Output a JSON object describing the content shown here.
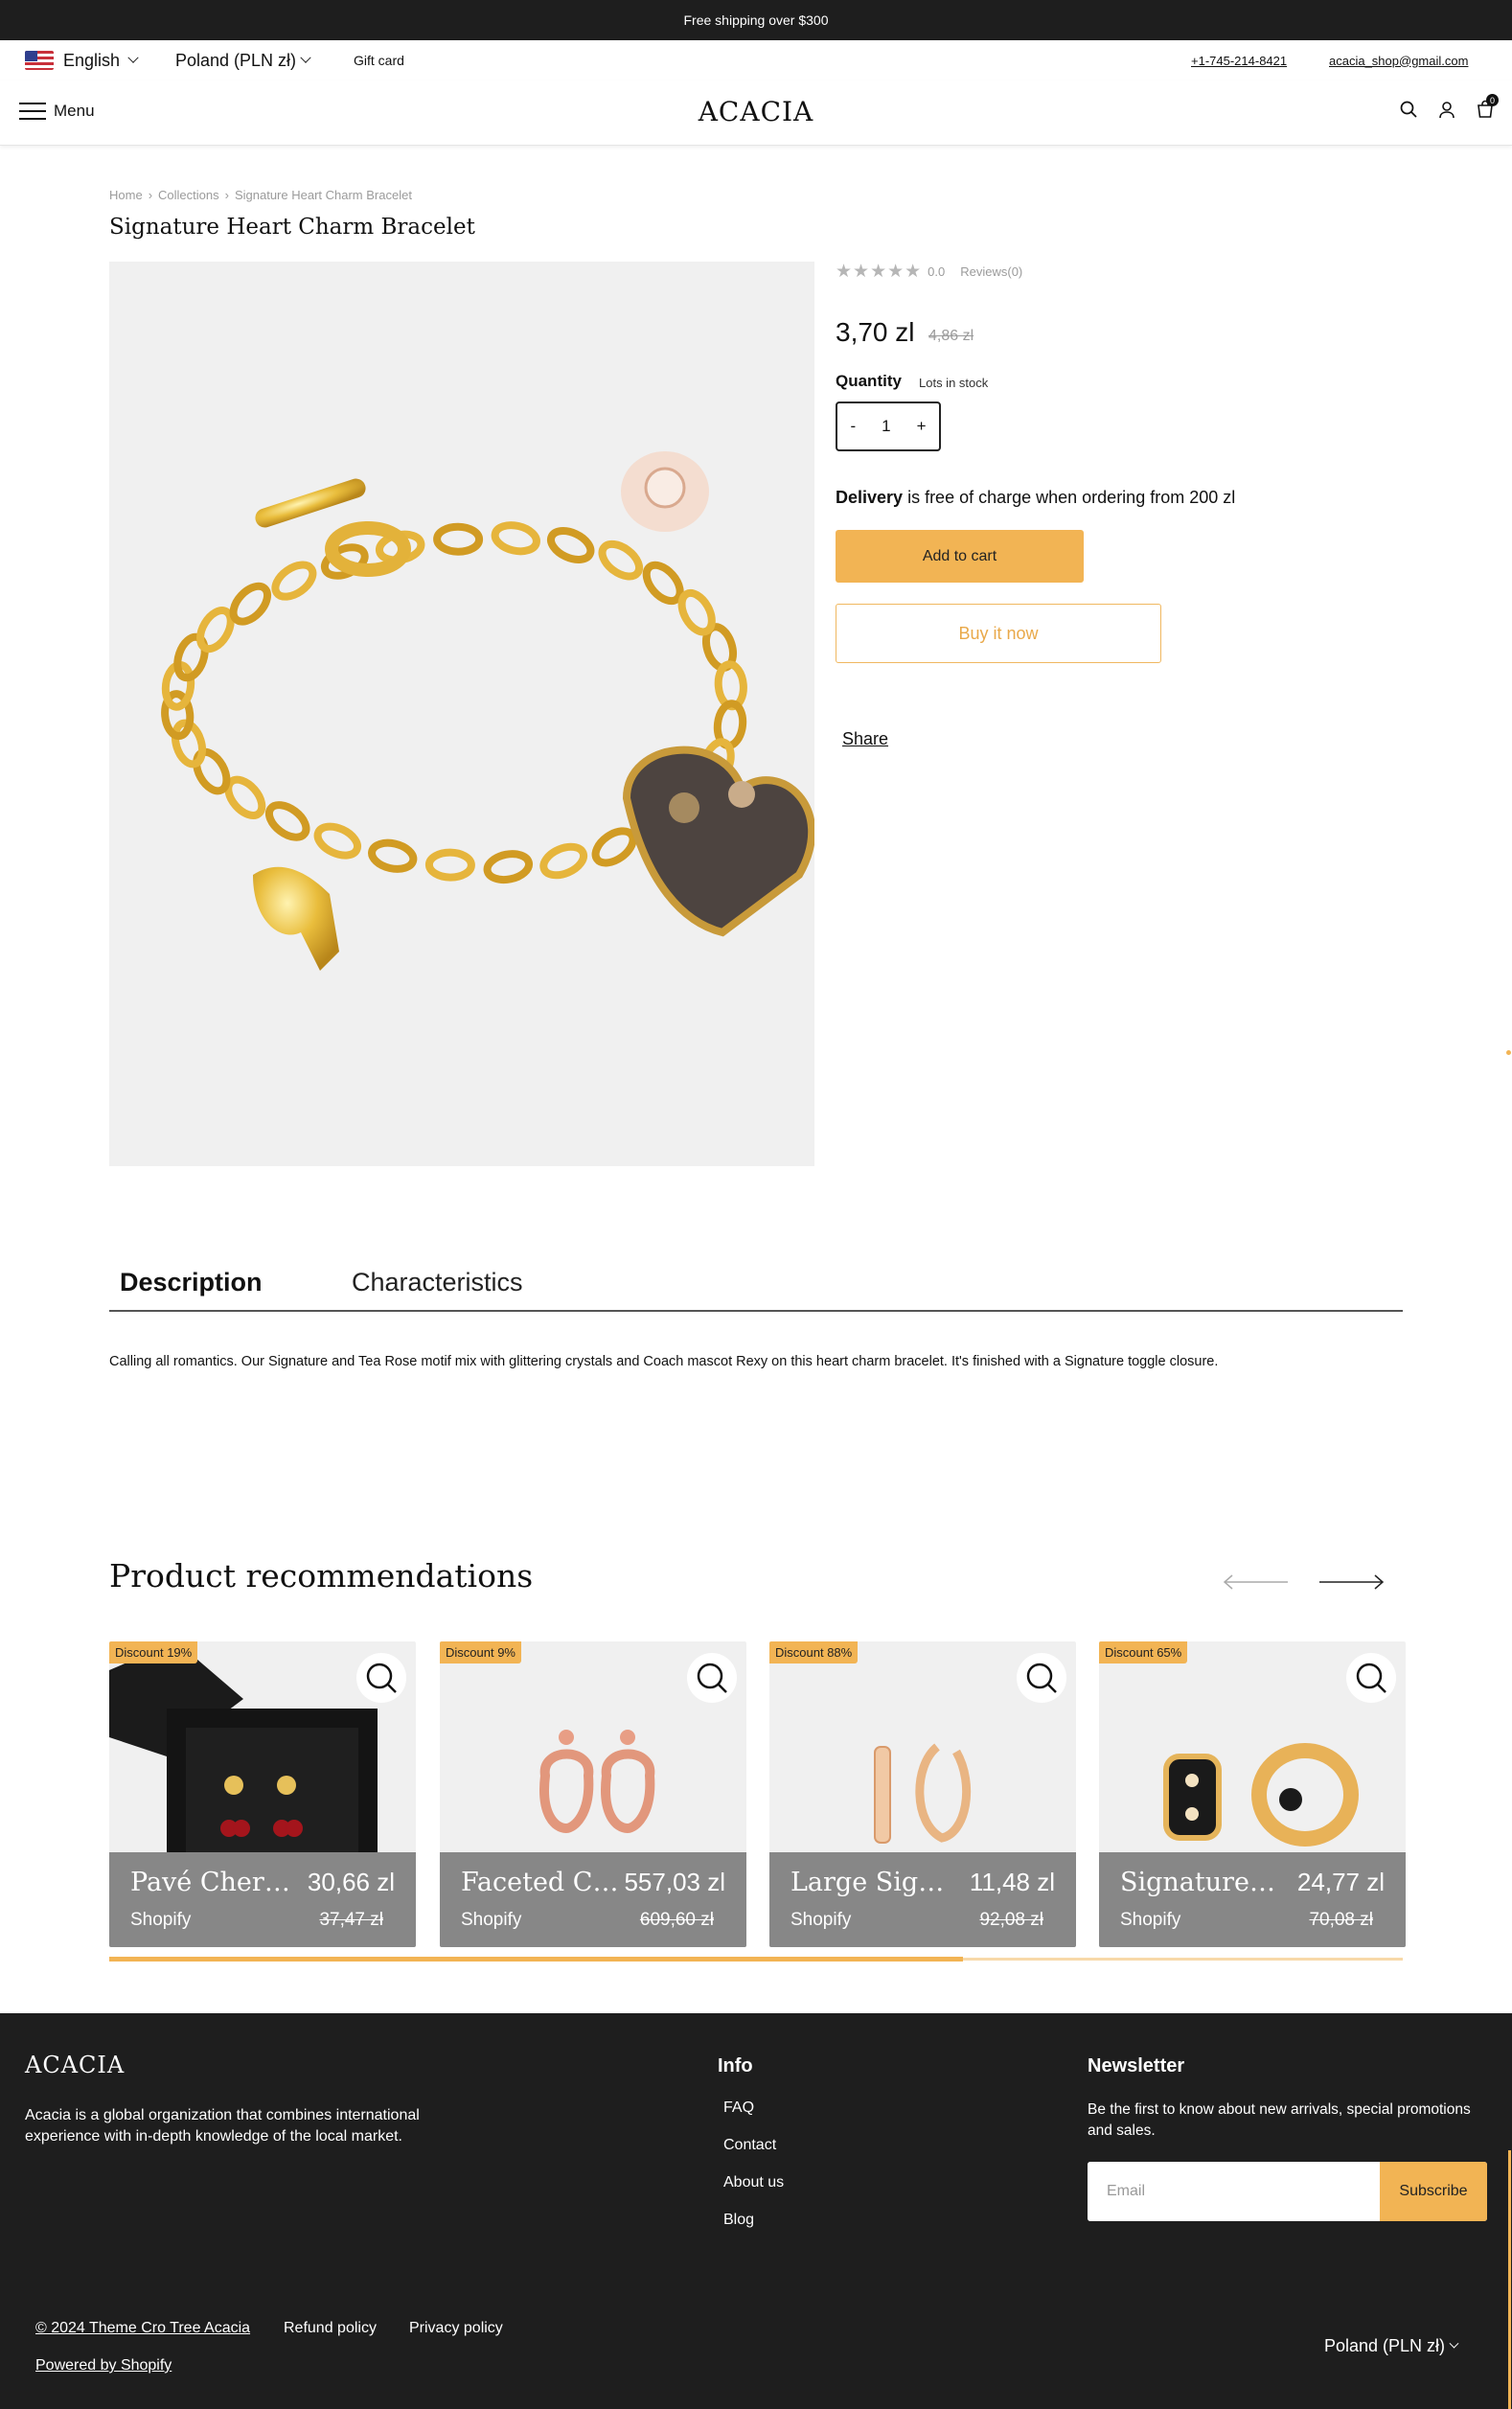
{
  "announcement": "Free shipping over $300",
  "topbar": {
    "language": "English",
    "country": "Poland (PLN zł)",
    "gift_card": "Gift card",
    "phone": "+1-745-214-8421",
    "email": "acacia_shop@gmail.com"
  },
  "header": {
    "menu_label": "Menu",
    "logo": "ACACIA",
    "cart_count": "0"
  },
  "breadcrumb": [
    "Home",
    "Collections",
    "Signature Heart Charm Bracelet"
  ],
  "product": {
    "title": "Signature Heart Charm Bracelet",
    "rating_stars": "★★★★★",
    "rating_value": "0.0",
    "reviews": "Reviews(0)",
    "price": "3,70 zl",
    "old_price": "4,86 zl",
    "quantity_label": "Quantity",
    "stock": "Lots in stock",
    "quantity_minus": "-",
    "quantity_value": "1",
    "quantity_plus": "+",
    "delivery_bold": "Delivery",
    "delivery_text": " is free of charge when ordering from 200 zl",
    "add_to_cart": "Add to cart",
    "buy_now": "Buy it now",
    "share": "Share"
  },
  "tabs": {
    "description": "Description",
    "characteristics": "Characteristics",
    "description_text": "Calling all romantics. Our Signature and Tea Rose motif mix with glittering crystals and Coach mascot Rexy on this heart charm bracelet. It's finished with a Signature toggle closure."
  },
  "recommendations": {
    "title": "Product recommendations",
    "items": [
      {
        "discount": "Discount 19%",
        "name": "Pavé Cherry Stud Earrings Set",
        "price": "30,66 zl",
        "vendor": "Shopify",
        "old_price": "37,47 zł"
      },
      {
        "discount": "Discount 9%",
        "name": "Faceted Coach Earrings",
        "price": "557,03 zl",
        "vendor": "Shopify",
        "old_price": "609,60 zł"
      },
      {
        "discount": "Discount 88%",
        "name": "Large Signature Hoops",
        "price": "11,48 zl",
        "vendor": "Shopify",
        "old_price": "92,08 zł"
      },
      {
        "discount": "Discount 65%",
        "name": "Signature Huggie Earrings",
        "price": "24,77 zl",
        "vendor": "Shopify",
        "old_price": "70,08 zł"
      }
    ],
    "scroll_progress": 0.66
  },
  "footer": {
    "logo": "ACACIA",
    "about": "Acacia is a global organization that combines international experience with in-depth knowledge of the local market.",
    "info_title": "Info",
    "info_links": [
      "FAQ",
      "Contact",
      "About us",
      "Blog"
    ],
    "newsletter_title": "Newsletter",
    "newsletter_text": "Be the first to know about new arrivals, special promotions and sales.",
    "email_placeholder": "Email",
    "subscribe": "Subscribe",
    "copyright": "© 2024 Theme Cro Tree Acacia",
    "refund": "Refund policy",
    "privacy": "Privacy policy",
    "powered": "Powered by Shopify",
    "country": "Poland (PLN zł)"
  },
  "colors": {
    "accent": "#f2b454",
    "dark": "#1e1e1e",
    "image_bg": "#f0f0f0"
  }
}
